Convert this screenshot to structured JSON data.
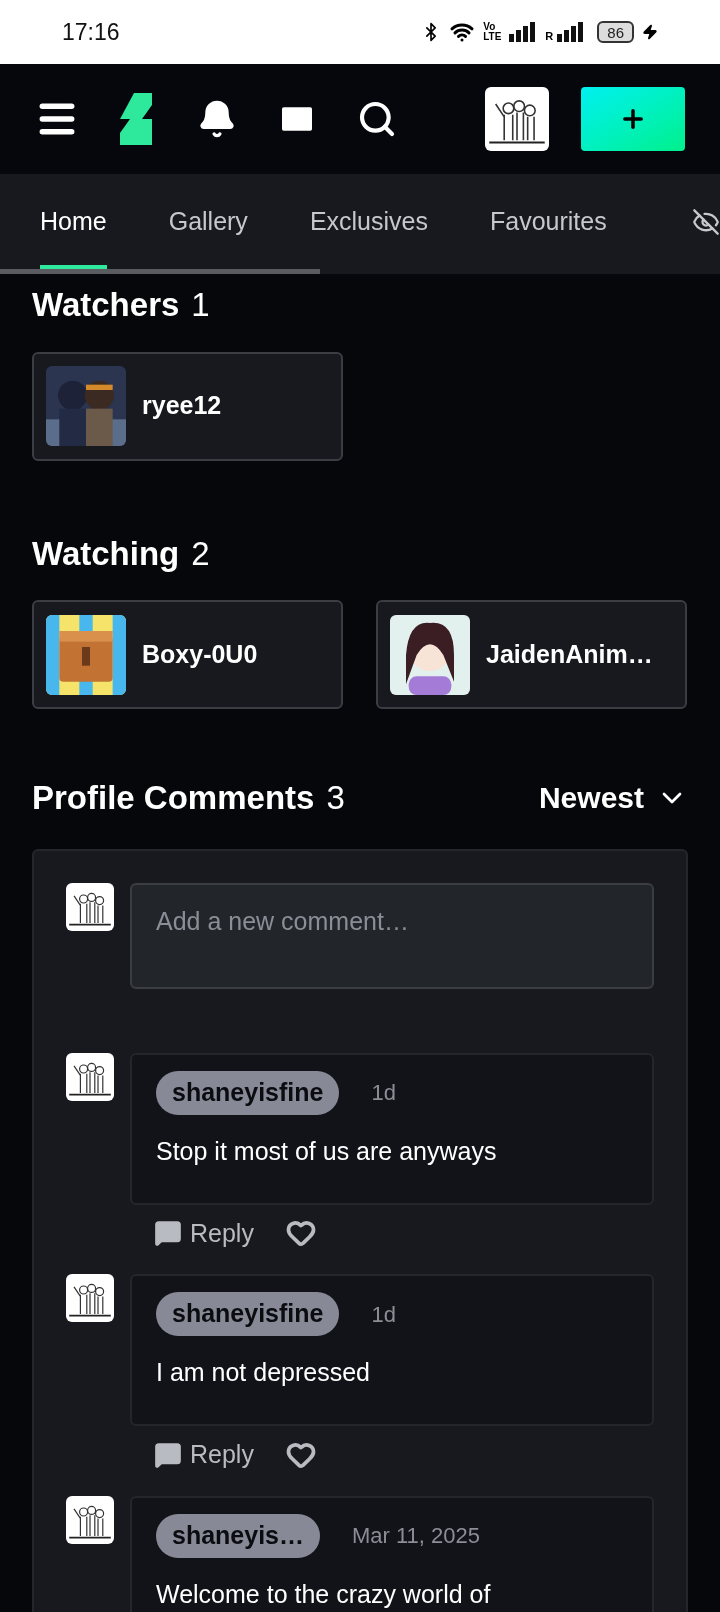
{
  "status_bar": {
    "time": "17:16",
    "volte_top": "Vo",
    "volte_bottom": "LTE",
    "roaming": "R",
    "battery": "86"
  },
  "tabs": [
    {
      "label": "Home",
      "selected": true
    },
    {
      "label": "Gallery",
      "selected": false
    },
    {
      "label": "Exclusives",
      "selected": false
    },
    {
      "label": "Favourites",
      "selected": false
    }
  ],
  "watchers": {
    "title": "Watchers",
    "count": "1",
    "users": [
      {
        "name": "ryee12"
      }
    ]
  },
  "watching": {
    "title": "Watching",
    "count": "2",
    "users": [
      {
        "name": "Boxy-0U0"
      },
      {
        "name": "JaidenAnim…"
      }
    ]
  },
  "comments": {
    "title": "Profile Comments",
    "count": "3",
    "sort": "Newest",
    "placeholder": "Add a new comment…",
    "items": [
      {
        "author": "shaneyisfine",
        "time": "1d",
        "text": "Stop it most of us are anyways",
        "reply": "Reply"
      },
      {
        "author": "shaneyisfine",
        "time": "1d",
        "text": "I am not depressed",
        "reply": "Reply"
      },
      {
        "author": "shaneyis…",
        "time": "Mar 11, 2025",
        "text": "Welcome to the crazy world of"
      }
    ]
  }
}
